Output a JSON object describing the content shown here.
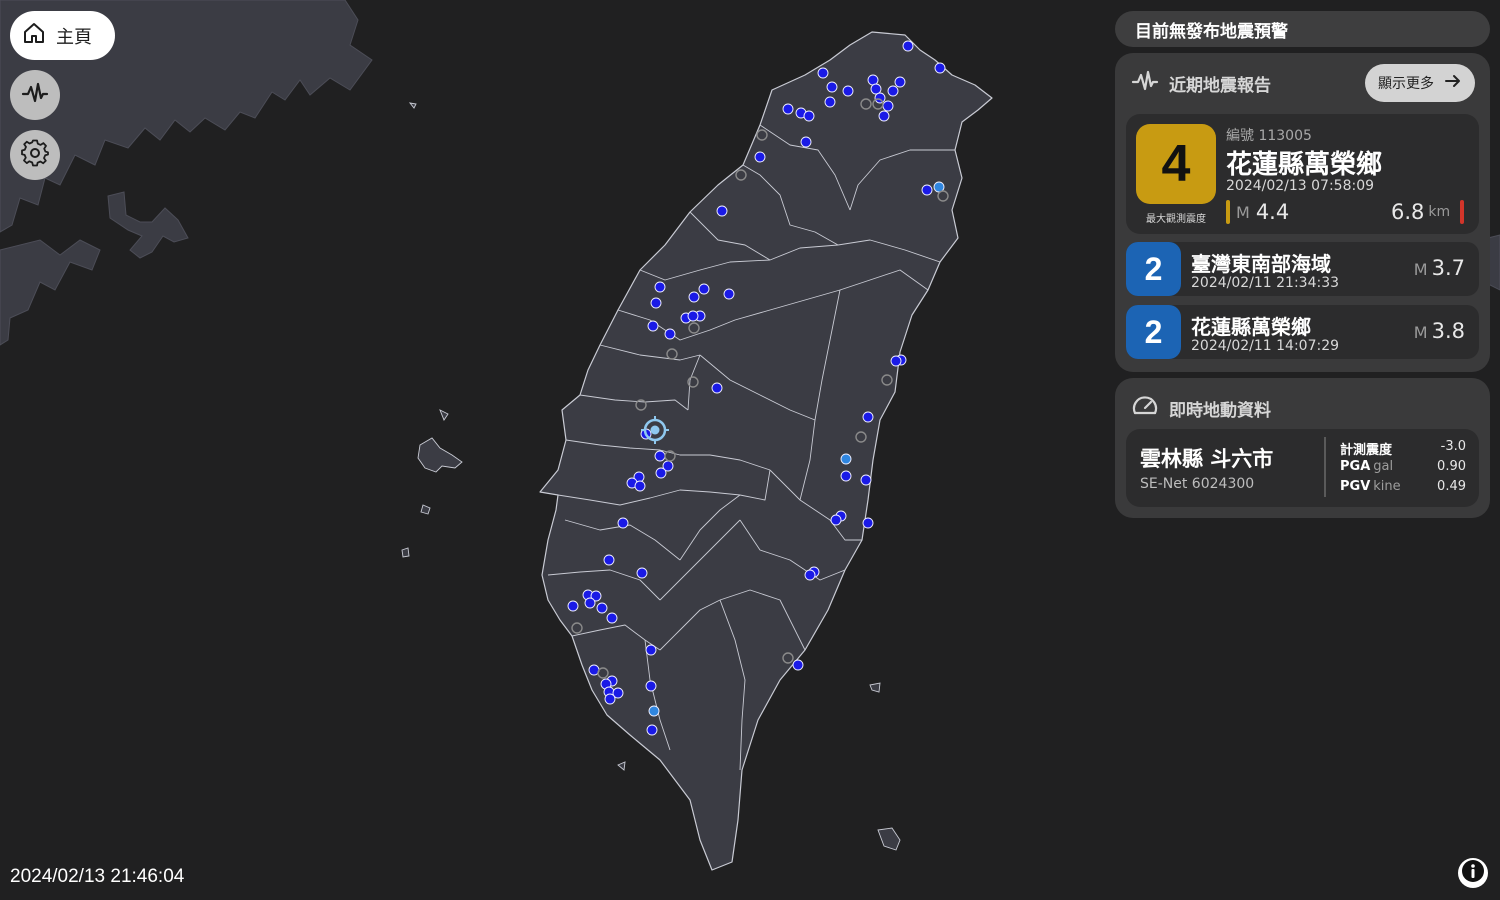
{
  "nav": {
    "home_label": "主頁",
    "home_icon": "home-icon",
    "waveform_icon": "waveform-icon",
    "settings_icon": "gear-icon"
  },
  "timestamp": "2024/02/13 21:46:04",
  "warning_status": "目前無發布地震預警",
  "recent_reports": {
    "title": "近期地震報告",
    "more_label": "顯示更多",
    "featured": {
      "id_label": "編號 113005",
      "intensity": "4",
      "intensity_caption": "最大觀測震度",
      "location": "花蓮縣萬榮鄉",
      "time": "2024/02/13 07:58:09",
      "mag_prefix": "M",
      "magnitude": "4.4",
      "depth": "6.8",
      "depth_unit": "km"
    },
    "items": [
      {
        "intensity": "2",
        "location": "臺灣東南部海域",
        "time": "2024/02/11 21:34:33",
        "mag_prefix": "M",
        "magnitude": "3.7"
      },
      {
        "intensity": "2",
        "location": "花蓮縣萬榮鄉",
        "time": "2024/02/11 14:07:29",
        "mag_prefix": "M",
        "magnitude": "3.8"
      }
    ]
  },
  "realtime": {
    "title": "即時地動資料",
    "station_name": "雲林縣 斗六市",
    "station_net": "SE-Net 6024300",
    "rows": [
      {
        "label": "計測震度",
        "unit": "",
        "value": "-3.0"
      },
      {
        "label": "PGA",
        "unit": "gal",
        "value": "0.90"
      },
      {
        "label": "PGV",
        "unit": "kine",
        "value": "0.49"
      }
    ]
  },
  "colors": {
    "background": "#202021",
    "land": "#3b3c44",
    "county_border": "#c9cbd4",
    "panel": "#3a3a3b",
    "card": "#2c2c2d",
    "intensity_4": "#c89b12",
    "intensity_2": "#1c64b4",
    "station_dot": "#1a1ae6"
  }
}
